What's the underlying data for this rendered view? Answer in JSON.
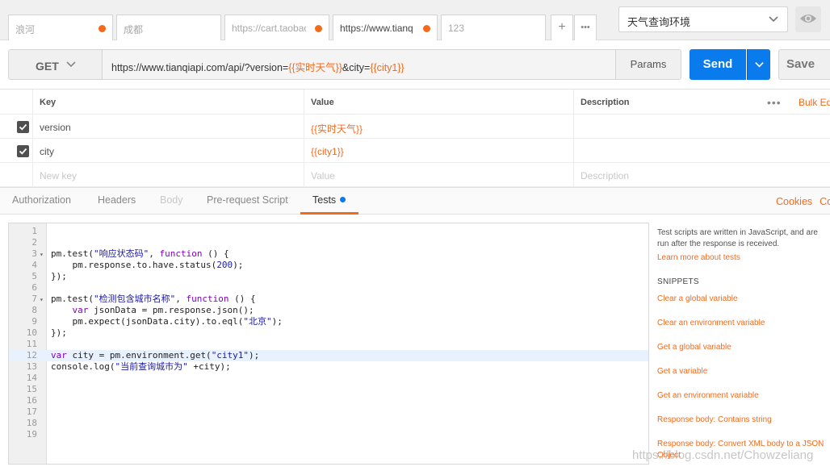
{
  "tabs": [
    {
      "label": "浪河",
      "dot": true
    },
    {
      "label": "成都",
      "dot": false
    },
    {
      "label": "https://cart.taobao",
      "dot": true
    },
    {
      "label": "https://www.tianq",
      "dot": true,
      "active": true
    },
    {
      "label": "123",
      "dot": false
    }
  ],
  "tab_actions": {
    "add": "+",
    "more": "•••"
  },
  "environment": {
    "selected": "天气查询环境"
  },
  "request": {
    "method": "GET",
    "url_parts": [
      {
        "text": "https://www.tianqiapi.com/api/?version=",
        "var": false
      },
      {
        "text": "{{实时天气}}",
        "var": true
      },
      {
        "text": "&city=",
        "var": false
      },
      {
        "text": "{{city1}}",
        "var": true
      }
    ],
    "params_label": "Params",
    "send_label": "Send",
    "save_label": "Save"
  },
  "params_table": {
    "headers": {
      "key": "Key",
      "value": "Value",
      "description": "Description"
    },
    "more": "•••",
    "bulk_edit": "Bulk Edit",
    "rows": [
      {
        "key": "version",
        "value": "{{实时天气}}",
        "description": ""
      },
      {
        "key": "city",
        "value": "{{city1}}",
        "description": ""
      }
    ],
    "new_row": {
      "key": "New key",
      "value": "Value",
      "description": "Description"
    }
  },
  "subtabs": [
    {
      "label": "Authorization",
      "state": "normal"
    },
    {
      "label": "Headers",
      "state": "normal"
    },
    {
      "label": "Body",
      "state": "disabled"
    },
    {
      "label": "Pre-request Script",
      "state": "normal"
    },
    {
      "label": "Tests",
      "state": "active"
    }
  ],
  "cookies_link": "Cookies",
  "code_label": "Code",
  "editor": {
    "lines": [
      {
        "n": "1",
        "code": ""
      },
      {
        "n": "2",
        "code": ""
      },
      {
        "n": "3",
        "fold": true,
        "code": "pm.test(\"响应状态码\", function () {"
      },
      {
        "n": "4",
        "code": "    pm.response.to.have.status(200);"
      },
      {
        "n": "5",
        "code": "});"
      },
      {
        "n": "6",
        "code": ""
      },
      {
        "n": "7",
        "fold": true,
        "code": "pm.test(\"检测包含城市名称\", function () {"
      },
      {
        "n": "8",
        "code": "    var jsonData = pm.response.json();"
      },
      {
        "n": "9",
        "code": "    pm.expect(jsonData.city).to.eql(\"北京\");"
      },
      {
        "n": "10",
        "code": "});"
      },
      {
        "n": "11",
        "code": ""
      },
      {
        "n": "12",
        "code": "var city = pm.environment.get(\"city1\");",
        "highlight": true
      },
      {
        "n": "13",
        "code": "console.log(\"当前查询城市为\" +city);"
      },
      {
        "n": "14",
        "code": ""
      },
      {
        "n": "15",
        "code": ""
      },
      {
        "n": "16",
        "code": ""
      },
      {
        "n": "17",
        "code": ""
      },
      {
        "n": "18",
        "code": ""
      },
      {
        "n": "19",
        "code": ""
      }
    ]
  },
  "help": {
    "description": "Test scripts are written in JavaScript, and are run after the response is received.",
    "learn_more": "Learn more about tests",
    "snippets_title": "SNIPPETS",
    "snippets": [
      "Clear a global variable",
      "Clear an environment variable",
      "Get a global variable",
      "Get a variable",
      "Get an environment variable",
      "Response body: Contains string",
      "Response body: Convert XML body to a JSON Object"
    ]
  },
  "watermark": "https://blog.csdn.net/Chowzeliang",
  "colors": {
    "accent": "#f26b1d",
    "send": "#097bed"
  }
}
